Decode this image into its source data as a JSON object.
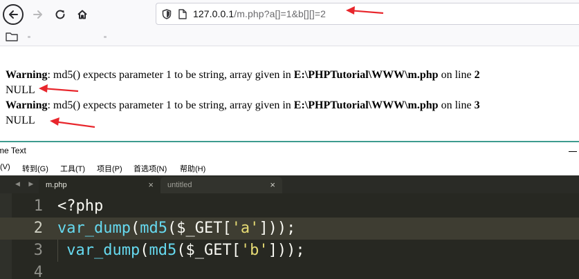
{
  "browser": {
    "url_host": "127.0.0.1",
    "url_path": "/m.php?a[]=1&b[][]=2",
    "icons": [
      "back-icon",
      "forward-icon",
      "reload-icon",
      "home-icon",
      "shield-icon",
      "page-icon"
    ],
    "output": [
      {
        "label": "Warning",
        "message": ": md5() expects parameter 1 to be string, array given in ",
        "file": "E:\\PHPTutorial\\WWW\\m.php",
        "on_line": " on line ",
        "line": "2"
      },
      {
        "label": "NULL"
      },
      {
        "label": "Warning",
        "message": ": md5() expects parameter 1 to be string, array given in ",
        "file": "E:\\PHPTutorial\\WWW\\m.php",
        "on_line": " on line ",
        "line": "3"
      },
      {
        "label": "NULL"
      }
    ],
    "annotation_color": "#e8262c"
  },
  "editor_app": {
    "title": "me Text",
    "menu": [
      "(V)",
      "转到(G)",
      "工具(T)",
      "项目(P)",
      "首选项(N)",
      "帮助(H)"
    ],
    "tabs": [
      {
        "label": "m.php",
        "active": true
      },
      {
        "label": "untitled",
        "active": false
      }
    ],
    "tab_close": "×",
    "tab_nav": "◀ ▶",
    "lines": [
      {
        "num": "1",
        "code": "<?php"
      },
      {
        "num": "2",
        "fn1": "var_dump",
        "p1": "(",
        "fn2": "md5",
        "p2": "($_GET[",
        "str": "'a'",
        "p3": "]));"
      },
      {
        "num": "3",
        "indent": " ",
        "fn1": "var_dump",
        "p1": "(",
        "fn2": "md5",
        "p2": "($_GET[",
        "str": "'b'",
        "p3": "]));"
      },
      {
        "num": "4",
        "code": ""
      }
    ],
    "colors": {
      "background": "#272822",
      "function": "#66d9ef",
      "string": "#e6db74",
      "text": "#f8f8f2"
    }
  }
}
